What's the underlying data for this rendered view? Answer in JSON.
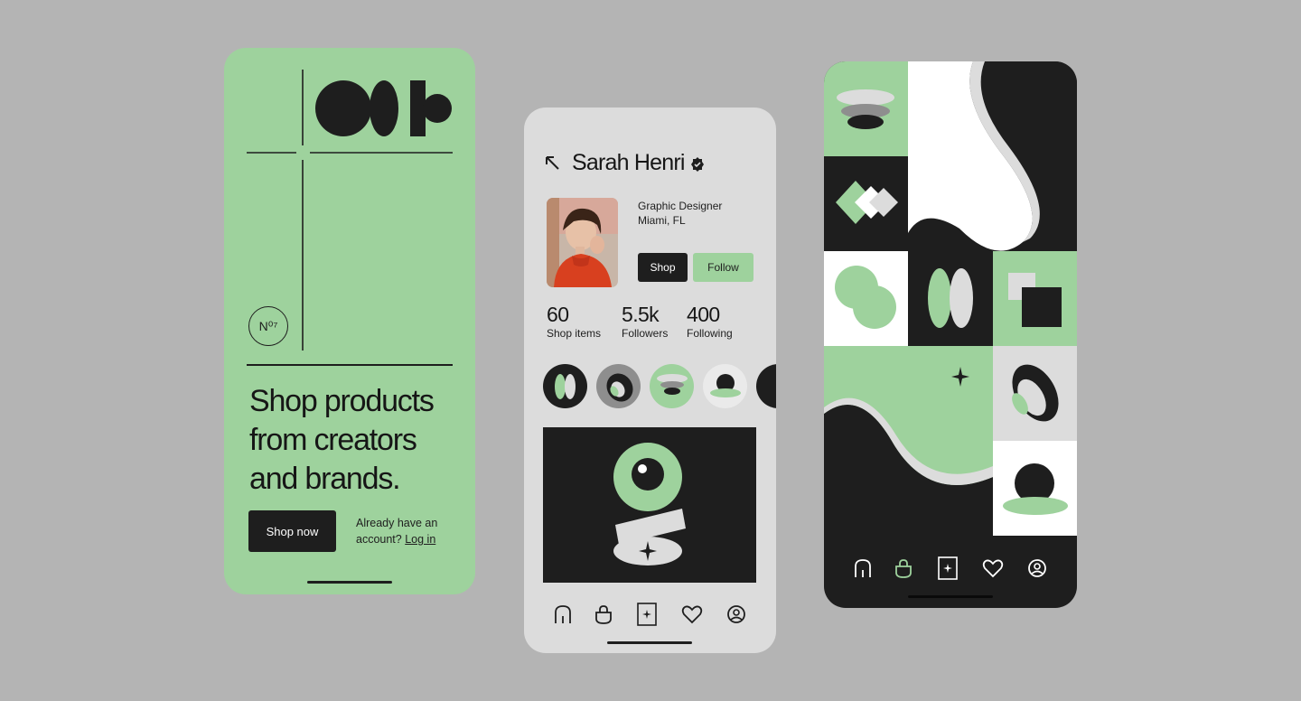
{
  "landing": {
    "headline_line1": "Shop products",
    "headline_line2": "from creators",
    "headline_line3": "and brands.",
    "badge": "N⁰⁷",
    "shop_now_label": "Shop now",
    "login_prompt": "Already have an account?",
    "login_link": "Log in"
  },
  "profile": {
    "name": "Sarah Henri",
    "role": "Graphic Designer",
    "location": "Miami, FL",
    "shop_label": "Shop",
    "follow_label": "Follow",
    "stats": [
      {
        "value": "60",
        "label": "Shop items"
      },
      {
        "value": "5.5k",
        "label": "Followers"
      },
      {
        "value": "400",
        "label": "Following"
      }
    ]
  },
  "nav": {
    "items": [
      "home-icon",
      "bag-icon",
      "sparkle-card-icon",
      "heart-icon",
      "profile-icon"
    ]
  },
  "colors": {
    "green": "#9ed29d",
    "dark": "#1e1e1e",
    "light_gray": "#dcdcdc",
    "background": "#b4b4b4"
  }
}
